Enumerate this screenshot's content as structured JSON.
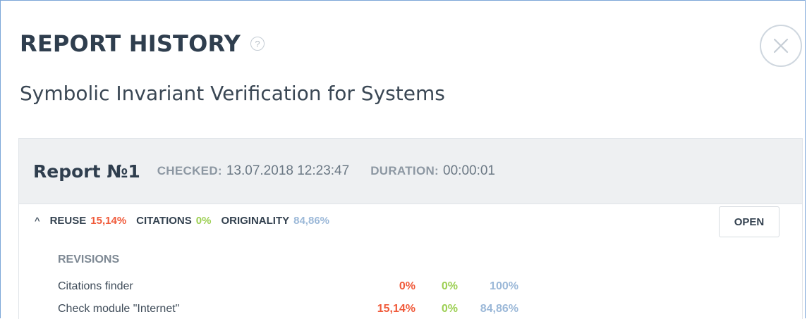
{
  "dialog": {
    "title": "REPORT HISTORY",
    "help_icon": "question-circle-icon",
    "close_icon": "close-x-icon",
    "subtitle": "Symbolic Invariant Verification for Systems"
  },
  "report": {
    "name": "Report №1",
    "checked_label": "CHECKED:",
    "checked_value": "13.07.2018 12:23:47",
    "duration_label": "DURATION:",
    "duration_value": "00:00:01",
    "caret": "^",
    "reuse_label": "REUSE",
    "reuse_value": "15,14%",
    "citations_label": "CITATIONS",
    "citations_value": "0%",
    "originality_label": "ORIGINALITY",
    "originality_value": "84,86%",
    "open_label": "OPEN"
  },
  "revisions": {
    "title": "REVISIONS",
    "rows": [
      {
        "name": "Citations finder",
        "reuse": "0%",
        "citations": "0%",
        "originality": "100%"
      },
      {
        "name": "Check module \"Internet\"",
        "reuse": "15,14%",
        "citations": "0%",
        "originality": "84,86%"
      }
    ]
  },
  "colors": {
    "reuse": "#f05a3a",
    "citations": "#9ccf52",
    "originality": "#9bb8d8",
    "border_accent": "#7ca6d8"
  }
}
